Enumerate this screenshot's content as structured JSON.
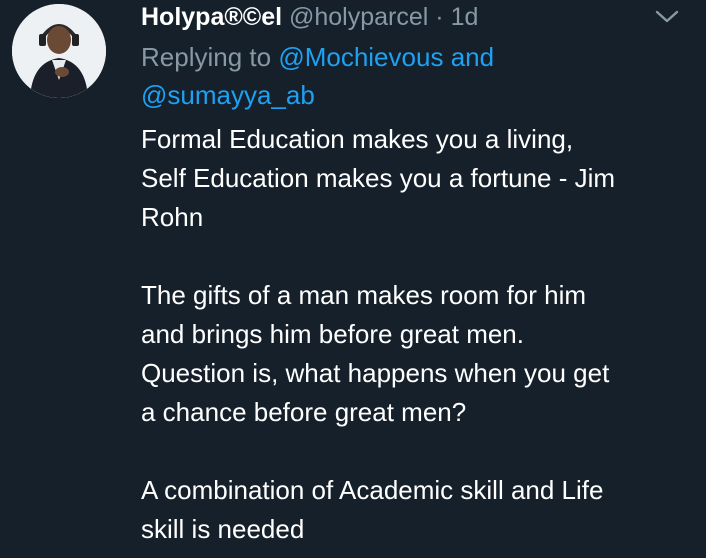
{
  "tweet": {
    "display_name": "Holypa®©el",
    "handle": "@holyparcel",
    "dot": "·",
    "timestamp": "1d",
    "replying_to": {
      "prefix": "Replying to",
      "mention_1": "@Mochievous",
      "conjunction": "and",
      "mention_2": "@sumayya_ab"
    },
    "paragraphs": [
      {
        "lines": [
          "Formal Education makes you a living,",
          "Self Education makes you a fortune - Jim",
          "Rohn"
        ]
      },
      {
        "lines": [
          "The gifts of a man makes room for him",
          "and brings him before great men.",
          "Question is, what happens when you get",
          "a chance before great men?"
        ]
      },
      {
        "lines": [
          "A combination of Academic skill and Life",
          "skill is needed"
        ]
      }
    ]
  },
  "icons": {
    "avatar": "profile-photo",
    "menu": "chevron-down-icon"
  },
  "colors": {
    "background": "#15202b",
    "primary_text": "#ffffff",
    "secondary_text": "#8899a6",
    "link": "#1da1f2"
  }
}
